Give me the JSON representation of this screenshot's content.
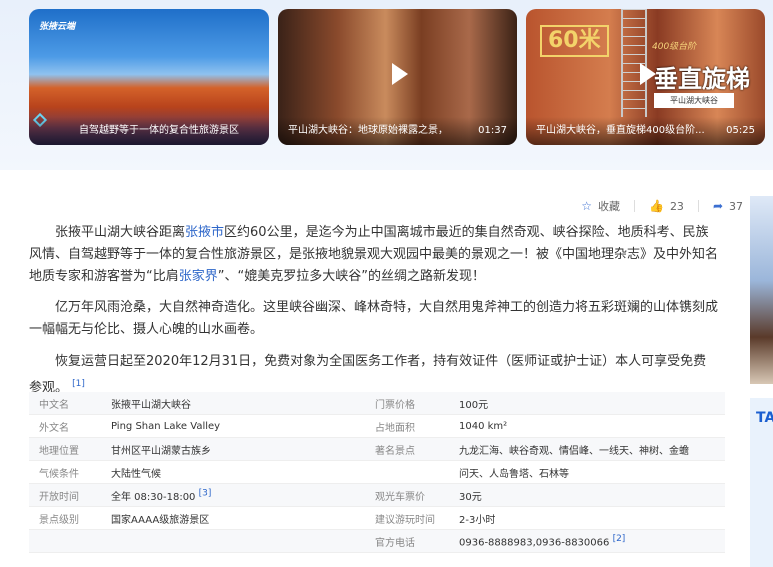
{
  "videos": [
    {
      "logo": "张掖云端",
      "caption": "自驾越野等于一体的复合性旅游景区",
      "duration": ""
    },
    {
      "caption": "平山湖大峡谷：地球原始裸露之景，",
      "duration": "01:37"
    },
    {
      "caption": "平山湖大峡谷，垂直旋梯400级台阶...",
      "duration": "05:25",
      "badge": "60米",
      "title": "垂直旋梯",
      "subtitle": "400级台阶",
      "tag": "平山湖大峡谷"
    }
  ],
  "toolbar": {
    "collect": "收藏",
    "likes": "23",
    "shares": "37"
  },
  "intro": {
    "p1_a": "张掖平山湖大峡谷距离",
    "p1_link": "张掖市",
    "p1_b": "区约60公里，是迄今为止中国离城市最近的集自然奇观、峡谷探险、地质科考、民族风情、自驾越野等于一体的复合性旅游景区，是张掖地貌景观大观园中最美的景观之一！被《中国地理杂志》及中外知名地质专家和游客誉为“比肩",
    "p1_link2": "张家界",
    "p1_c": "”、“媲美克罗拉多大峡谷”的丝绸之路新发现！",
    "p2": "亿万年风雨沧桑，大自然神奇造化。这里峡谷幽深、峰林奇特，大自然用鬼斧神工的创造力将五彩斑斓的山体镌刻成一幅幅无与伦比、摄人心魄的山水画卷。",
    "p3": "恢复运营日起至2020年12月31日，免费对象为全国医务工作者，持有效证件（医师证或护士证）本人可享受免费参观。",
    "p3_ref": "[1]"
  },
  "info": [
    {
      "k": "中文名",
      "v": "张掖平山湖大峡谷",
      "k2": "门票价格",
      "v2": "100元"
    },
    {
      "k": "外文名",
      "v": "Ping Shan Lake Valley",
      "k2": "占地面积",
      "v2": "1040 km²"
    },
    {
      "k": "地理位置",
      "v": "甘州区平山湖蒙古族乡",
      "k2": "著名景点",
      "v2": "九龙汇海、峡谷奇观、情侣峰、一线天、神树、金蟾"
    },
    {
      "k": "气候条件",
      "v": "大陆性气候",
      "k2": "",
      "v2": "问天、人岛鲁塔、石林等"
    },
    {
      "k": "开放时间",
      "v": "全年 08:30-18:00",
      "ref": "[3]",
      "k2": "观光车票价",
      "v2": "30元"
    },
    {
      "k": "景点级别",
      "v": "国家AAAA级旅游景区",
      "k2": "建议游玩时间",
      "v2": "2-3小时"
    },
    {
      "k": "",
      "v": "",
      "k2": "官方电话",
      "v2": "0936-8888983,0936-8830066",
      "ref2": "[2]"
    }
  ],
  "side": {
    "label": "TA"
  }
}
